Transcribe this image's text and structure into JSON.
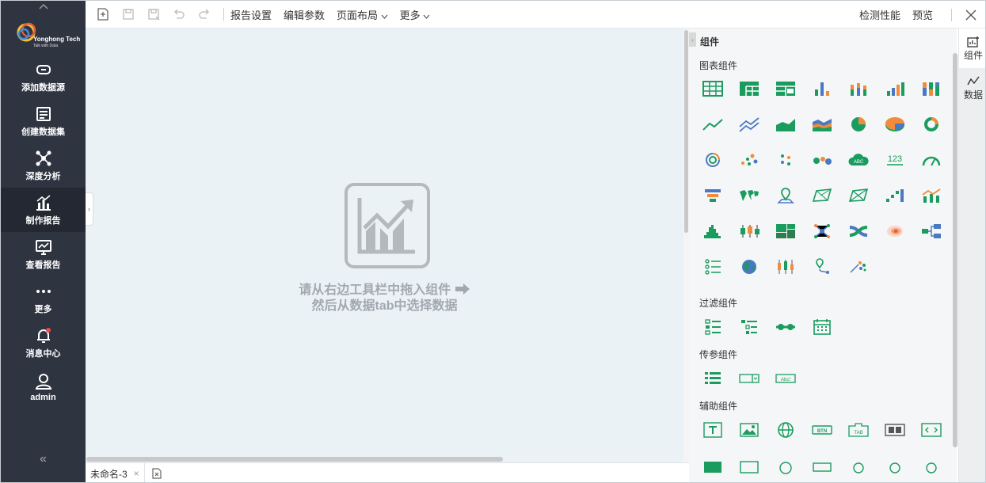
{
  "sidebar": {
    "logo": {
      "name": "Yonghong Tech",
      "tagline": "Talk with Data"
    },
    "items": [
      {
        "label": "添加数据源",
        "icon": "link-icon"
      },
      {
        "label": "创建数据集",
        "icon": "dataset-icon"
      },
      {
        "label": "深度分析",
        "icon": "network-icon"
      },
      {
        "label": "制作报告",
        "icon": "bar-chart-icon",
        "active": true
      },
      {
        "label": "查看报告",
        "icon": "monitor-chart-icon"
      },
      {
        "label": "更多",
        "icon": "more-dots-icon"
      },
      {
        "label": "消息中心",
        "icon": "bell-icon"
      },
      {
        "label": "admin",
        "icon": "user-icon"
      }
    ],
    "collapse": "«"
  },
  "toolbar": {
    "menus": [
      "报告设置",
      "编辑参数",
      "页面布局",
      "更多"
    ],
    "right": [
      "检测性能",
      "预览"
    ]
  },
  "canvas": {
    "hint_line1": "请从右边工具栏中拖入组件",
    "hint_line2": "然后从数据tab中选择数据"
  },
  "panel": {
    "title": "组件",
    "sections": {
      "chart": "图表组件",
      "filter": "过滤组件",
      "param": "传参组件",
      "aux": "辅助组件"
    },
    "aux_button": "BTN",
    "aux_tab": "TAB",
    "param_text": "Abc!",
    "chart_number": "123",
    "chart_cloud": "ABC"
  },
  "right_tabs": [
    {
      "label": "组件",
      "icon": "component-icon"
    },
    {
      "label": "数据",
      "icon": "data-icon"
    }
  ],
  "bottom": {
    "tab": "未命名-3",
    "close": "×"
  },
  "colors": {
    "sidebar": "#2f3441",
    "accent": "#1a9c5f",
    "blue": "#4a78c2",
    "orange": "#f08c3c",
    "canvas": "#ebf2f5"
  }
}
